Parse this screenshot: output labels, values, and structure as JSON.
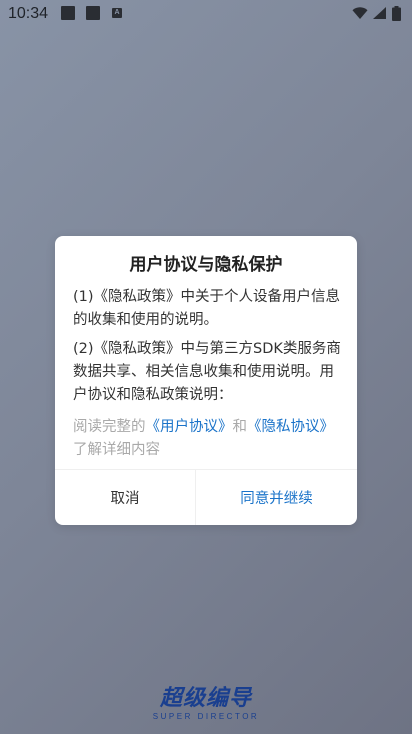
{
  "status_bar": {
    "time": "10:34",
    "notif_letter": "A",
    "icons": [
      "notification-icon",
      "notification-icon",
      "keyboard-icon",
      "wifi-icon",
      "signal-icon",
      "battery-icon"
    ]
  },
  "dialog": {
    "title": "用户协议与隐私保护",
    "paragraphs": [
      "(1)《隐私政策》中关于个人设备用户信息的收集和使用的说明。",
      "(2)《隐私政策》中与第三方SDK类服务商数据共享、相关信息收集和使用说明。用户协议和隐私政策说明："
    ],
    "read_prefix": "阅读完整的",
    "user_agreement_link": "《用户协议》",
    "read_and": "和",
    "privacy_link": "《隐私协议》",
    "read_suffix": "了解详细内容",
    "cancel_label": "取消",
    "agree_label": "同意并继续"
  },
  "logo": {
    "main": "超级编导",
    "sub": "SUPER DIRECTOR"
  },
  "colors": {
    "link": "#1a73c9",
    "logo": "#1a3f8f"
  }
}
